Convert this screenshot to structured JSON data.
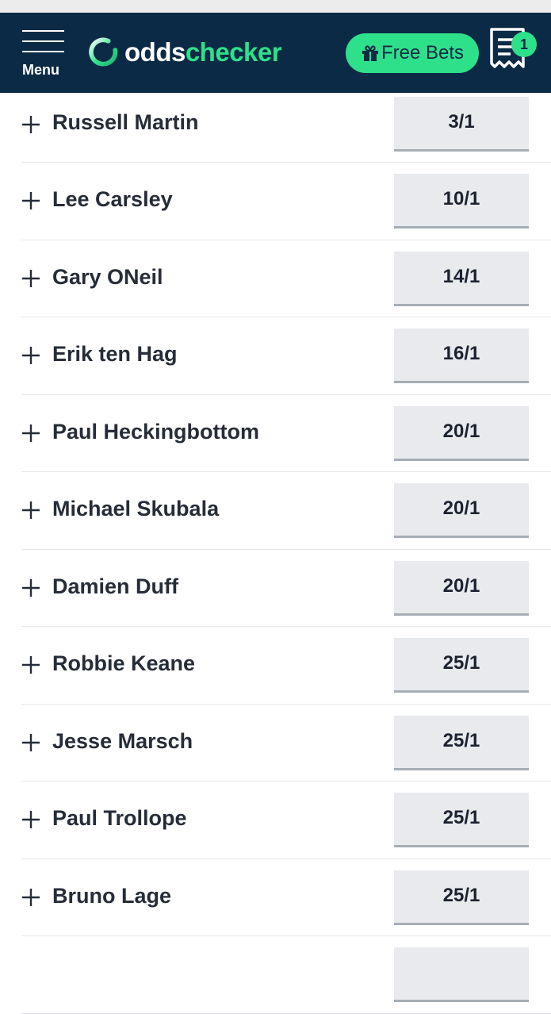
{
  "header": {
    "menu_label": "Menu",
    "logo": {
      "part1": "odds",
      "part2": "checker"
    },
    "free_bets_label": "Free Bets",
    "betslip_count": "1"
  },
  "colors": {
    "header_bg": "#0b2a45",
    "accent": "#2fe08b",
    "odds_button_bg": "#e8eaed",
    "row_divider": "#e4e6ea"
  },
  "rows": [
    {
      "name": "Russell Martin",
      "odds": "3/1"
    },
    {
      "name": "Lee Carsley",
      "odds": "10/1"
    },
    {
      "name": "Gary ONeil",
      "odds": "14/1"
    },
    {
      "name": "Erik ten Hag",
      "odds": "16/1"
    },
    {
      "name": "Paul Heckingbottom",
      "odds": "20/1"
    },
    {
      "name": "Michael Skubala",
      "odds": "20/1"
    },
    {
      "name": "Damien Duff",
      "odds": "20/1"
    },
    {
      "name": "Robbie Keane",
      "odds": "25/1"
    },
    {
      "name": "Jesse Marsch",
      "odds": "25/1"
    },
    {
      "name": "Paul Trollope",
      "odds": "25/1"
    },
    {
      "name": "Bruno Lage",
      "odds": "25/1"
    }
  ],
  "icons": {
    "menu": "hamburger-icon",
    "logo": "logo-ring-icon",
    "free_bets": "gift-icon",
    "betslip": "receipt-icon",
    "row_expand": "plus-icon"
  }
}
